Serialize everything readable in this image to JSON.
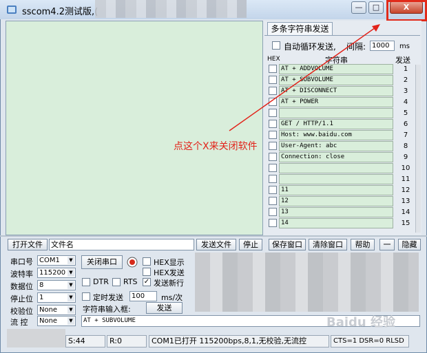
{
  "window": {
    "title": "sscom4.2测试版,(",
    "min_icon": "minimize-icon",
    "max_icon": "maximize-icon",
    "close_icon": "close-icon",
    "close_glyph": "X"
  },
  "multi_string": {
    "tab_label": "多条字符串发送",
    "auto_loop_label": "自动循环发送,",
    "interval_label": "间隔:",
    "interval_value": "1000",
    "interval_unit": "ms",
    "col_hex": "HEX",
    "col_string": "字符串",
    "col_send": "发送",
    "rows": [
      {
        "text": "AT + ADDVOLUME",
        "num": "1"
      },
      {
        "text": "AT + SUBVOLUME",
        "num": "2"
      },
      {
        "text": "AT + DISCONNECT",
        "num": "3"
      },
      {
        "text": "AT + POWER",
        "num": "4"
      },
      {
        "text": "",
        "num": "5"
      },
      {
        "text": "GET / HTTP/1.1",
        "num": "6"
      },
      {
        "text": "Host: www.baidu.com",
        "num": "7"
      },
      {
        "text": "User-Agent: abc",
        "num": "8"
      },
      {
        "text": "Connection: close",
        "num": "9"
      },
      {
        "text": "",
        "num": "10"
      },
      {
        "text": "",
        "num": "11"
      },
      {
        "text": "11",
        "num": "12"
      },
      {
        "text": "12",
        "num": "13"
      },
      {
        "text": "13",
        "num": "14"
      },
      {
        "text": "14",
        "num": "15"
      }
    ]
  },
  "annotation": "点这个X来关闭软件",
  "file_bar": {
    "open_file": "打开文件",
    "file_name": "文件名",
    "send_file": "发送文件",
    "stop": "停止",
    "save_window": "保存窗口",
    "clear_window": "清除窗口",
    "help": "帮助",
    "dash": "一",
    "hide": "隐藏"
  },
  "settings": {
    "port_label": "串口号",
    "port_value": "COM1",
    "baud_label": "波特率",
    "baud_value": "115200",
    "data_label": "数据位",
    "data_value": "8",
    "stop_label": "停止位",
    "stop_value": "1",
    "parity_label": "校验位",
    "parity_value": "None",
    "flow_label": "流 控",
    "flow_value": "None",
    "close_port": "关闭串口",
    "hex_show": "HEX显示",
    "hex_send": "HEX发送",
    "dtr": "DTR",
    "rts": "RTS",
    "newline": "发送新行",
    "timed_send": "定时发送",
    "timed_value": "100",
    "timed_unit": "ms/次",
    "input_label": "字符串输入框:",
    "send": "发送",
    "input_value": "AT + SUBVOLUME"
  },
  "status_bar": {
    "sent": "S:44",
    "recv": "R:0",
    "port_status": "COM1已打开  115200bps,8,1,无校验,无流控",
    "lines": "CTS=1 DSR=0 RLSD"
  },
  "watermark": "Baidu 经验",
  "colors": {
    "receive_area": "#d9eedb",
    "annotation": "#e2231a",
    "highlight_box": "#e12a1a"
  }
}
